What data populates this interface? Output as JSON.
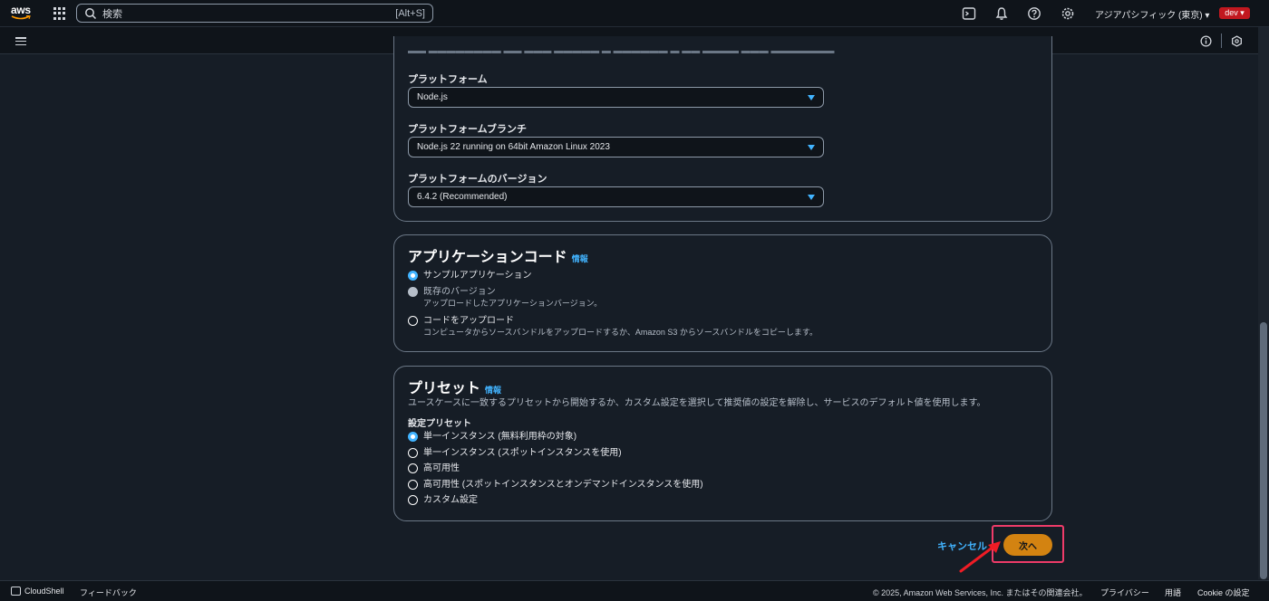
{
  "nav": {
    "logo": "aws",
    "search_placeholder": "検索",
    "search_shortcut": "[Alt+S]",
    "region": "アジアパシフィック (東京) ▾",
    "account": "dev ▾",
    "icons": [
      "cloudshell-icon",
      "bell-icon",
      "help-icon",
      "gear-icon"
    ]
  },
  "platform": {
    "platform_label": "プラットフォーム",
    "platform_value": "Node.js",
    "branch_label": "プラットフォームブランチ",
    "branch_value": "Node.js 22 running on 64bit Amazon Linux 2023",
    "version_label": "プラットフォームのバージョン",
    "version_value": "6.4.2 (Recommended)"
  },
  "app_code": {
    "title": "アプリケーションコード",
    "info": "情報",
    "options": [
      {
        "label": "サンプルアプリケーション",
        "desc": "",
        "state": "selected"
      },
      {
        "label": "既存のバージョン",
        "desc": "アップロードしたアプリケーションバージョン。",
        "state": "disabled"
      },
      {
        "label": "コードをアップロード",
        "desc": "コンピュータからソースバンドルをアップロードするか、Amazon S3 からソースバンドルをコピーします。",
        "state": "unselected"
      }
    ]
  },
  "presets": {
    "title": "プリセット",
    "info": "情報",
    "description": "ユースケースに一致するプリセットから開始するか、カスタム設定を選択して推奨値の設定を解除し、サービスのデフォルト値を使用します。",
    "group_label": "設定プリセット",
    "options": [
      {
        "label": "単一インスタンス (無料利用枠の対象)",
        "state": "selected"
      },
      {
        "label": "単一インスタンス (スポットインスタンスを使用)",
        "state": "unselected"
      },
      {
        "label": "高可用性",
        "state": "unselected"
      },
      {
        "label": "高可用性 (スポットインスタンスとオンデマンドインスタンスを使用)",
        "state": "unselected"
      },
      {
        "label": "カスタム設定",
        "state": "unselected"
      }
    ]
  },
  "actions": {
    "cancel": "キャンセル",
    "next": "次へ"
  },
  "footer": {
    "cloudshell": "CloudShell",
    "feedback": "フィードバック",
    "copyright": "© 2025, Amazon Web Services, Inc. またはその関連会社。",
    "privacy": "プライバシー",
    "terms": "用語",
    "cookie": "Cookie の設定"
  },
  "colors": {
    "accent": "#42b4ff",
    "primary_button": "#d38311",
    "highlight": "#ef3b69",
    "background": "#161d26"
  }
}
